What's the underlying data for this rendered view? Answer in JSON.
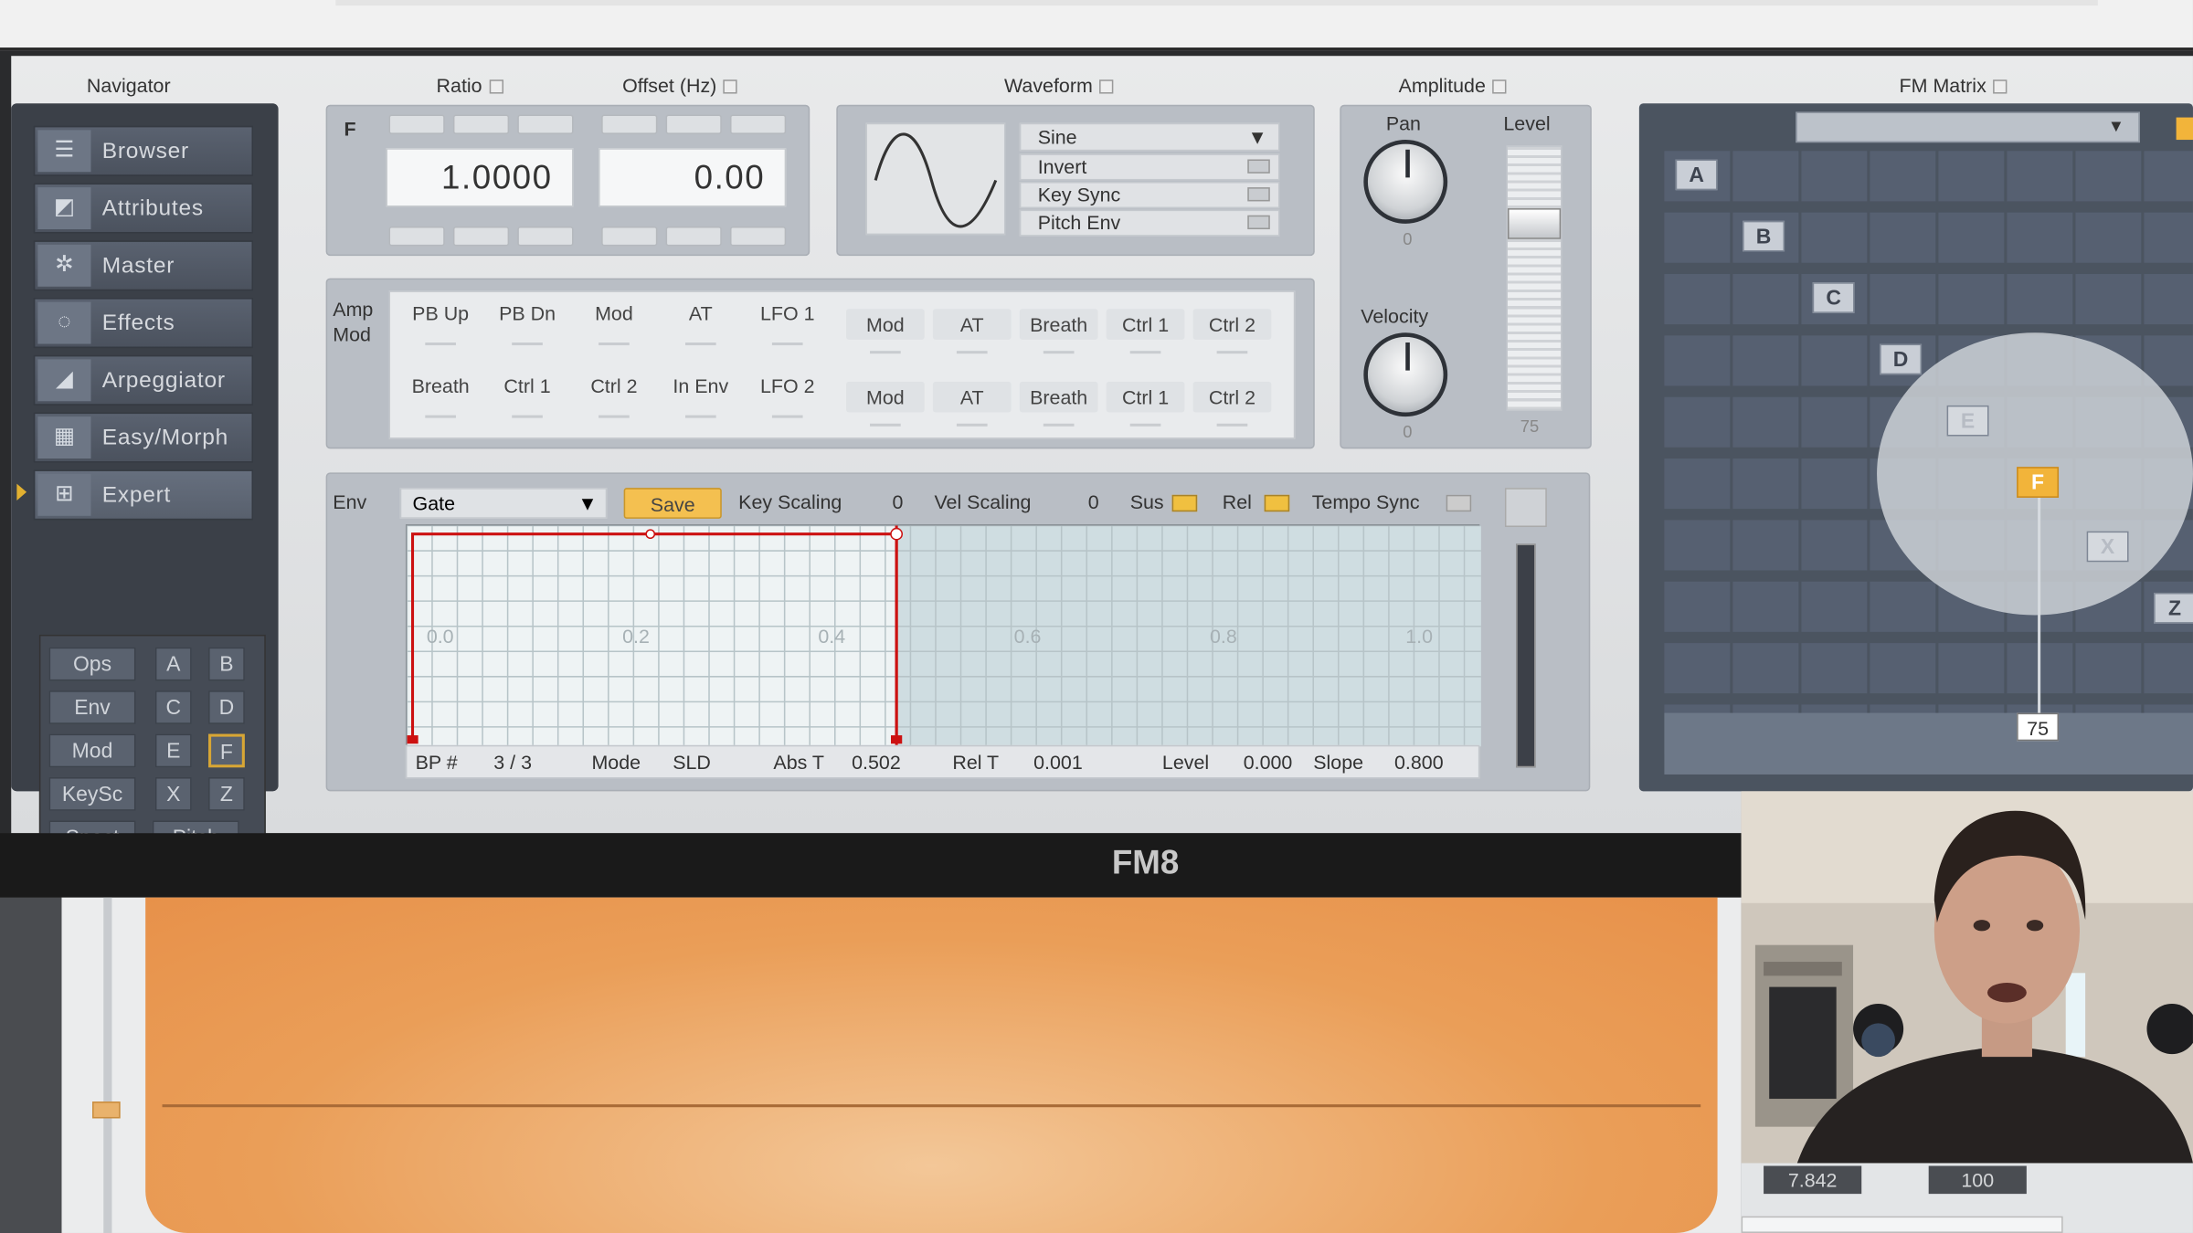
{
  "app_title": "FM8",
  "headers": {
    "navigator": "Navigator",
    "ratio": "Ratio",
    "offset": "Offset (Hz)",
    "waveform": "Waveform",
    "amplitude": "Amplitude",
    "fm_matrix": "FM Matrix"
  },
  "nav": {
    "items": [
      {
        "label": "Browser",
        "icon": "browser-icon",
        "glyph": "☰"
      },
      {
        "label": "Attributes",
        "icon": "attributes-icon",
        "glyph": "◩"
      },
      {
        "label": "Master",
        "icon": "master-icon",
        "glyph": "✲"
      },
      {
        "label": "Effects",
        "icon": "effects-icon",
        "glyph": "◌"
      },
      {
        "label": "Arpeggiator",
        "icon": "arpeggiator-icon",
        "glyph": "◢"
      },
      {
        "label": "Easy/Morph",
        "icon": "easy-morph-icon",
        "glyph": "▦"
      },
      {
        "label": "Expert",
        "icon": "expert-icon",
        "glyph": "⊞"
      }
    ],
    "active": "Expert",
    "grid": [
      [
        "Ops",
        "A",
        "B"
      ],
      [
        "Env",
        "C",
        "D"
      ],
      [
        "Mod",
        "E",
        "F"
      ],
      [
        "KeySc",
        "X",
        "Z"
      ],
      [
        "Spect",
        "Pitch"
      ]
    ],
    "selected_operator": "F"
  },
  "operator": {
    "label": "F",
    "ratio": "1.0000",
    "offset": "0.00"
  },
  "waveform": {
    "selected": "Sine",
    "options": [
      "Invert",
      "Key Sync",
      "Pitch Env"
    ]
  },
  "ampmod": {
    "label_line1": "Amp",
    "label_line2": "Mod",
    "row1_left": [
      "PB Up",
      "PB Dn",
      "Mod",
      "AT",
      "LFO 1"
    ],
    "row2_left": [
      "Breath",
      "Ctrl 1",
      "Ctrl 2",
      "In Env",
      "LFO 2"
    ],
    "row1_right": [
      "Mod",
      "AT",
      "Breath",
      "Ctrl 1",
      "Ctrl 2"
    ],
    "row2_right": [
      "Mod",
      "AT",
      "Breath",
      "Ctrl 1",
      "Ctrl 2"
    ]
  },
  "amplitude": {
    "pan_label": "Pan",
    "velocity_label": "Velocity",
    "level_label": "Level",
    "pan_value": "0",
    "velocity_value": "0",
    "level_value": "75"
  },
  "env": {
    "label": "Env",
    "mode_select": "Gate",
    "save": "Save",
    "key_scaling_label": "Key Scaling",
    "key_scaling_value": "0",
    "vel_scaling_label": "Vel Scaling",
    "vel_scaling_value": "0",
    "sus_label": "Sus",
    "rel_label": "Rel",
    "tempo_sync_label": "Tempo Sync",
    "time_labels": [
      "0.0",
      "0.2",
      "0.4",
      "0.6",
      "0.8",
      "1.0"
    ],
    "status": {
      "bp_label": "BP #",
      "bp_value": "3 / 3",
      "mode_label": "Mode",
      "mode_value": "SLD",
      "abs_t_label": "Abs T",
      "abs_t_value": "0.502",
      "rel_t_label": "Rel T",
      "rel_t_value": "0.001",
      "level_label": "Level",
      "level_value": "0.000",
      "slope_label": "Slope",
      "slope_value": "0.800"
    }
  },
  "fm_matrix": {
    "operators": [
      "A",
      "B",
      "C",
      "D",
      "E",
      "F",
      "X",
      "Z"
    ],
    "selected": "F",
    "level_readout": "75"
  },
  "colors": {
    "accent": "#e2b030",
    "env_line": "#cc1111",
    "panel": "#b9bec5",
    "nav": "#3b4048"
  },
  "below_values": [
    "7.842",
    "100"
  ]
}
